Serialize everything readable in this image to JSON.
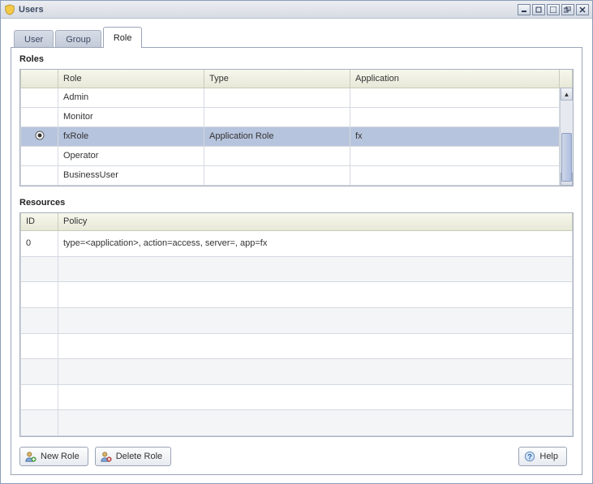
{
  "window": {
    "title": "Users"
  },
  "tabs": [
    {
      "label": "User",
      "active": false
    },
    {
      "label": "Group",
      "active": false
    },
    {
      "label": "Role",
      "active": true
    }
  ],
  "roles_section": {
    "label": "Roles",
    "columns": {
      "role": "Role",
      "type": "Type",
      "application": "Application"
    },
    "rows": [
      {
        "role": "Admin",
        "type": "",
        "application": "",
        "selected": false
      },
      {
        "role": "Monitor",
        "type": "",
        "application": "",
        "selected": false
      },
      {
        "role": "fxRole",
        "type": "Application Role",
        "application": "fx",
        "selected": true
      },
      {
        "role": "Operator",
        "type": "",
        "application": "",
        "selected": false
      },
      {
        "role": "BusinessUser",
        "type": "",
        "application": "",
        "selected": false
      }
    ]
  },
  "resources_section": {
    "label": "Resources",
    "columns": {
      "id": "ID",
      "policy": "Policy"
    },
    "rows": [
      {
        "id": "0",
        "policy": "type=<application>, action=access, server=, app=fx"
      },
      {
        "id": "",
        "policy": ""
      },
      {
        "id": "",
        "policy": ""
      },
      {
        "id": "",
        "policy": ""
      },
      {
        "id": "",
        "policy": ""
      },
      {
        "id": "",
        "policy": ""
      },
      {
        "id": "",
        "policy": ""
      },
      {
        "id": "",
        "policy": ""
      }
    ]
  },
  "buttons": {
    "new_role": "New Role",
    "delete_role": "Delete Role",
    "help": "Help"
  }
}
